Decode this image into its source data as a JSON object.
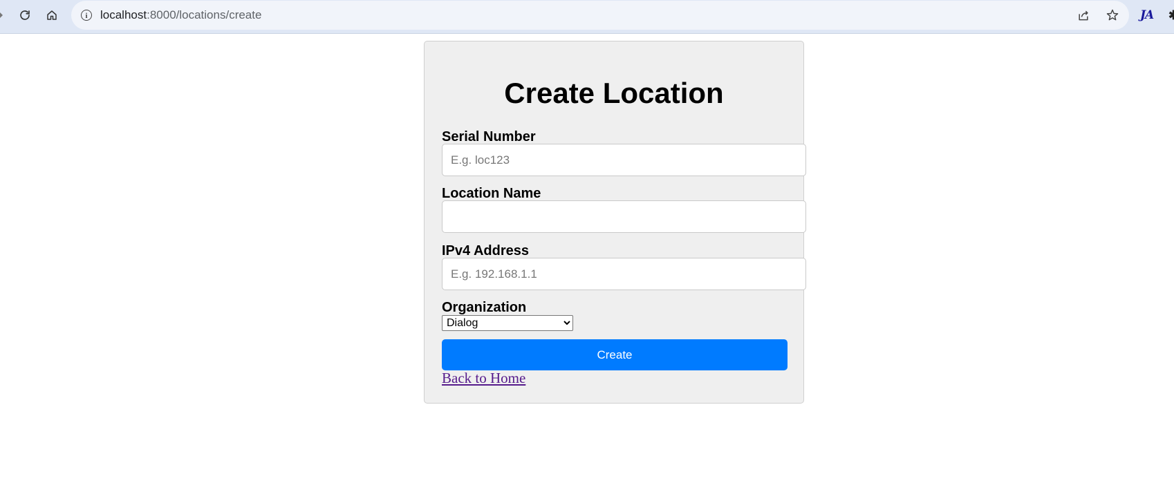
{
  "browser": {
    "url_host": "localhost",
    "url_path": ":8000/locations/create",
    "extension_label": "JA"
  },
  "form": {
    "title": "Create Location",
    "serial_number": {
      "label": "Serial Number",
      "value": "",
      "placeholder": "E.g. loc123"
    },
    "location_name": {
      "label": "Location Name",
      "value": "",
      "placeholder": ""
    },
    "ipv4_address": {
      "label": "IPv4 Address",
      "value": "",
      "placeholder": "E.g. 192.168.1.1"
    },
    "organization": {
      "label": "Organization",
      "selected": "Dialog"
    },
    "submit_label": "Create",
    "back_link_label": "Back to Home"
  },
  "colors": {
    "primary_button": "#007bff",
    "card_background": "#efefef",
    "visited_link": "#551a8b"
  }
}
